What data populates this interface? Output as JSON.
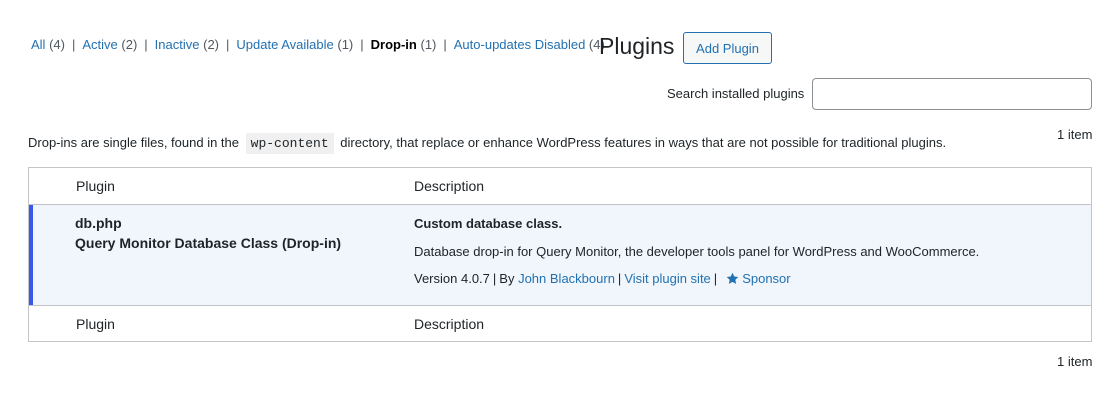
{
  "filters": {
    "all": {
      "label": "All",
      "count": "(4)"
    },
    "active": {
      "label": "Active",
      "count": "(2)"
    },
    "inactive": {
      "label": "Inactive",
      "count": "(2)"
    },
    "update_available": {
      "label": "Update Available",
      "count": "(1)"
    },
    "dropin": {
      "label": "Drop-in",
      "count": "(1)"
    },
    "autoupdates_disabled": {
      "label": "Auto-updates Disabled",
      "count": "(4)"
    },
    "separator": "|"
  },
  "header": {
    "title": "Plugins",
    "add_button": "Add Plugin"
  },
  "search": {
    "label": "Search installed plugins",
    "value": ""
  },
  "pagination": {
    "top_count": "1 item",
    "bottom_count": "1 item"
  },
  "note": {
    "before": "Drop-ins are single files, found in the",
    "code": "wp-content",
    "after": "directory, that replace or enhance WordPress features in ways that are not possible for traditional plugins."
  },
  "table": {
    "columns": {
      "plugin": "Plugin",
      "description": "Description"
    },
    "rows": [
      {
        "file": "db.php",
        "name": "Query Monitor Database Class (Drop-in)",
        "desc_title": "Custom database class.",
        "desc_text": "Database drop-in for Query Monitor, the developer tools panel for WordPress and WooCommerce.",
        "version": "Version 4.0.7",
        "by": "By",
        "author": "John Blackbourn",
        "visit": "Visit plugin site",
        "sponsor": "Sponsor",
        "sponsor_icon": "star-icon"
      }
    ]
  },
  "colors": {
    "link": "#2271b1",
    "active_row_bg": "#f0f6fc",
    "active_row_border": "#3858e9"
  }
}
